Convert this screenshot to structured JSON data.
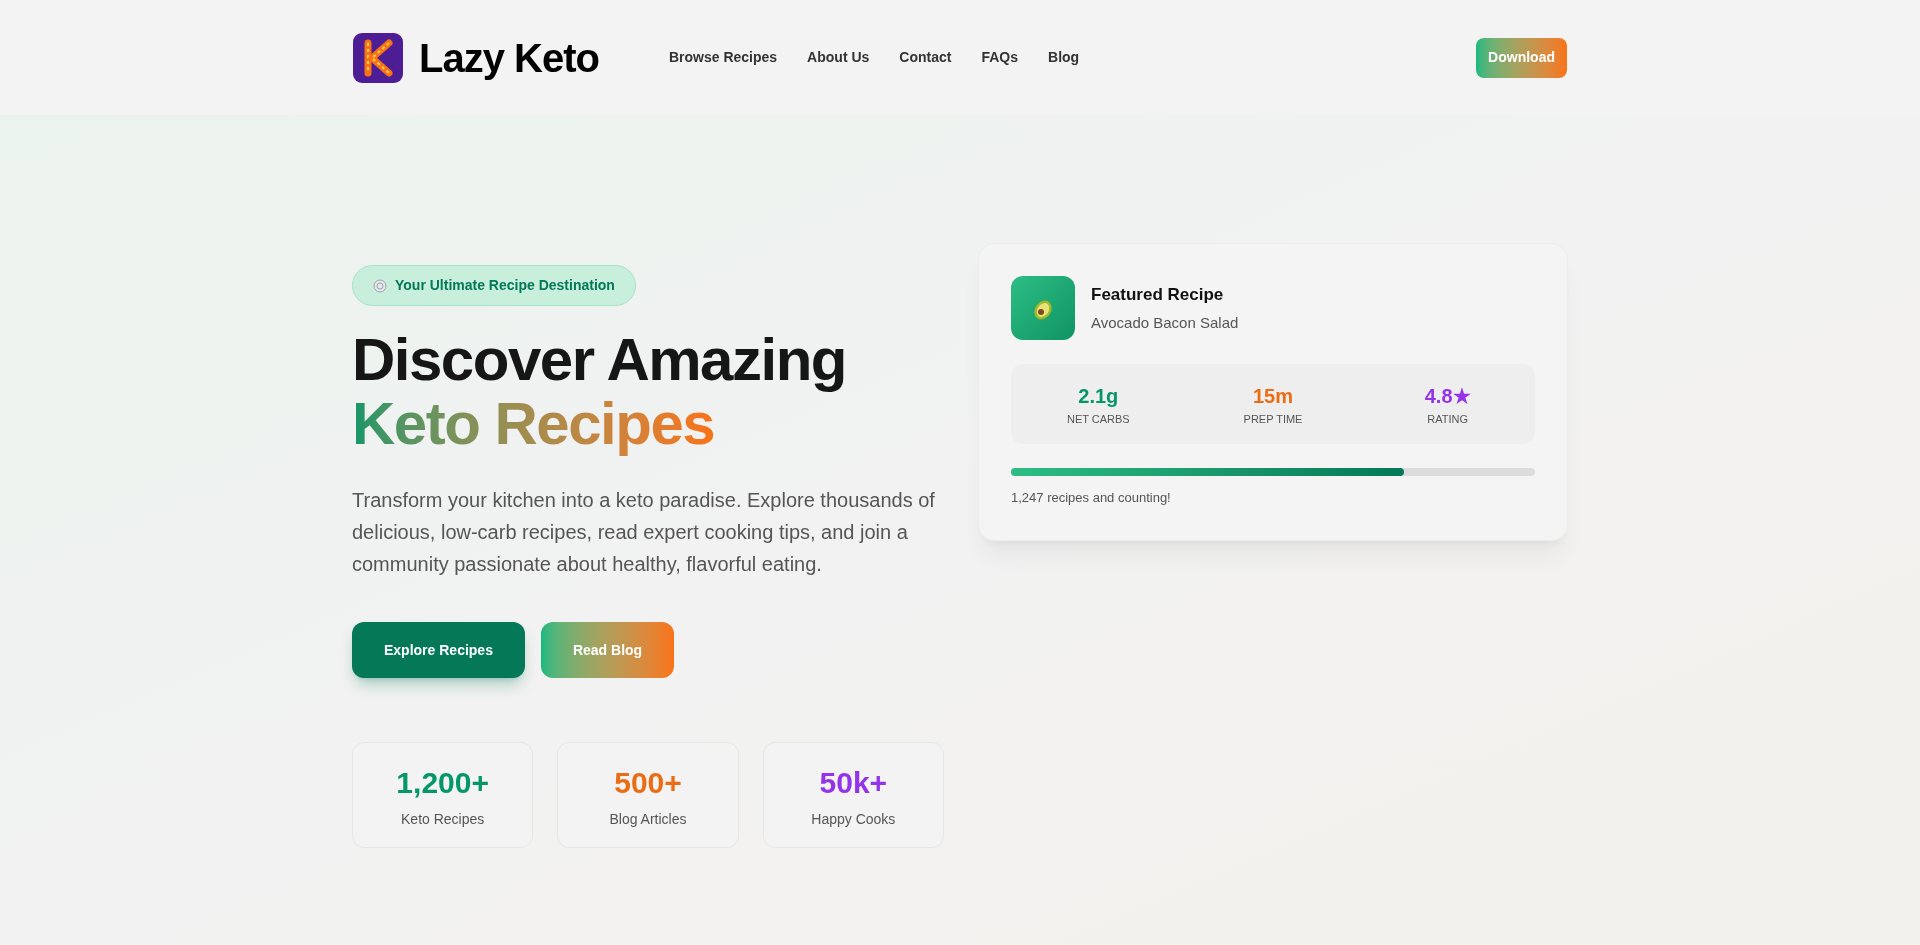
{
  "header": {
    "brand": "Lazy Keto",
    "nav": [
      {
        "label": "Browse Recipes"
      },
      {
        "label": "About Us"
      },
      {
        "label": "Contact"
      },
      {
        "label": "FAQs"
      },
      {
        "label": "Blog"
      }
    ],
    "cta": "Download"
  },
  "hero": {
    "badge": "Your Ultimate Recipe Destination",
    "title_line1": "Discover Amazing",
    "title_line2": "Keto Recipes",
    "description": "Transform your kitchen into a keto paradise. Explore thousands of delicious, low-carb recipes, read expert cooking tips, and join a community passionate about healthy, flavorful eating.",
    "buttons": [
      {
        "label": "Explore Recipes",
        "kind": "solid"
      },
      {
        "label": "Read Blog",
        "kind": "gradient"
      }
    ],
    "stats": [
      {
        "value": "1,200+",
        "label": "Keto Recipes",
        "color": "#059669"
      },
      {
        "value": "500+",
        "label": "Blog Articles",
        "color": "#ea6c14"
      },
      {
        "value": "50k+",
        "label": "Happy Cooks",
        "color": "#9333ea"
      }
    ]
  },
  "featured": {
    "title": "Featured Recipe",
    "recipe": "Avocado Bacon Salad",
    "facts": [
      {
        "value": "2.1g",
        "label": "NET CARBS",
        "color": "#059669"
      },
      {
        "value": "15m",
        "label": "PREP TIME",
        "color": "#ea6c14"
      },
      {
        "value": "4.8★",
        "label": "RATING",
        "color": "#9333ea"
      }
    ],
    "progress": {
      "level": 0.75
    },
    "caption": "1,247 recipes and counting!"
  }
}
